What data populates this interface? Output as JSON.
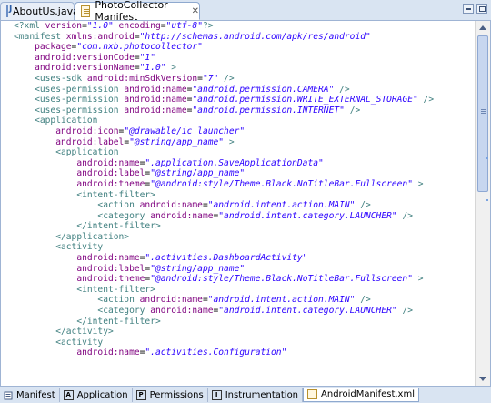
{
  "tabs": [
    {
      "label": "AboutUs.java",
      "icon": "java-file-icon",
      "active": false
    },
    {
      "label": "PhotoCollector Manifest",
      "icon": "xml-file-icon",
      "active": true
    }
  ],
  "close_glyph": "✕",
  "code_lines": [
    {
      "indent": 0,
      "fold": false,
      "warn": true,
      "parts": [
        {
          "t": "<?xml ",
          "c": "pi"
        },
        {
          "t": "version",
          "c": "attr"
        },
        {
          "t": "=",
          "c": ""
        },
        {
          "t": "\"1.0\"",
          "c": "val"
        },
        {
          "t": " ",
          "c": ""
        },
        {
          "t": "encoding",
          "c": "attr"
        },
        {
          "t": "=",
          "c": ""
        },
        {
          "t": "\"utf-8\"",
          "c": "val"
        },
        {
          "t": "?>",
          "c": "pi"
        }
      ]
    },
    {
      "indent": 0,
      "fold": true,
      "parts": [
        {
          "t": "<manifest ",
          "c": "tag"
        },
        {
          "t": "xmlns:android",
          "c": "attr"
        },
        {
          "t": "=",
          "c": ""
        },
        {
          "t": "\"http://schemas.android.com/apk/res/android\"",
          "c": "val"
        }
      ]
    },
    {
      "indent": 4,
      "parts": [
        {
          "t": "package",
          "c": "attr"
        },
        {
          "t": "=",
          "c": ""
        },
        {
          "t": "\"com.nxb.photocollector\"",
          "c": "val"
        }
      ]
    },
    {
      "indent": 4,
      "parts": [
        {
          "t": "android:versionCode",
          "c": "attr"
        },
        {
          "t": "=",
          "c": ""
        },
        {
          "t": "\"1\"",
          "c": "val"
        }
      ]
    },
    {
      "indent": 4,
      "parts": [
        {
          "t": "android:versionName",
          "c": "attr"
        },
        {
          "t": "=",
          "c": ""
        },
        {
          "t": "\"1.0\"",
          "c": "val"
        },
        {
          "t": " >",
          "c": "tag"
        }
      ]
    },
    {
      "indent": 4,
      "parts": [
        {
          "t": "<uses-sdk ",
          "c": "tag"
        },
        {
          "t": "android:minSdkVersion",
          "c": "attr"
        },
        {
          "t": "=",
          "c": ""
        },
        {
          "t": "\"7\"",
          "c": "val"
        },
        {
          "t": " />",
          "c": "tag"
        }
      ]
    },
    {
      "indent": 4,
      "parts": [
        {
          "t": "<uses-permission ",
          "c": "tag"
        },
        {
          "t": "android:name",
          "c": "attr"
        },
        {
          "t": "=",
          "c": ""
        },
        {
          "t": "\"android.permission.CAMERA\"",
          "c": "val"
        },
        {
          "t": " />",
          "c": "tag"
        }
      ]
    },
    {
      "indent": 4,
      "parts": [
        {
          "t": "<uses-permission ",
          "c": "tag"
        },
        {
          "t": "android:name",
          "c": "attr"
        },
        {
          "t": "=",
          "c": ""
        },
        {
          "t": "\"android.permission.WRITE_EXTERNAL_STORAGE\"",
          "c": "val"
        },
        {
          "t": " />",
          "c": "tag"
        }
      ]
    },
    {
      "indent": 4,
      "parts": [
        {
          "t": "<uses-permission ",
          "c": "tag"
        },
        {
          "t": "android:name",
          "c": "attr"
        },
        {
          "t": "=",
          "c": ""
        },
        {
          "t": "\"android.permission.INTERNET\"",
          "c": "val"
        },
        {
          "t": " />",
          "c": "tag"
        }
      ]
    },
    {
      "indent": 4,
      "fold": true,
      "parts": [
        {
          "t": "<application",
          "c": "tag"
        }
      ]
    },
    {
      "indent": 8,
      "parts": [
        {
          "t": "android:icon",
          "c": "attr"
        },
        {
          "t": "=",
          "c": ""
        },
        {
          "t": "\"@drawable/ic_launcher\"",
          "c": "val"
        }
      ]
    },
    {
      "indent": 8,
      "parts": [
        {
          "t": "android:label",
          "c": "attr"
        },
        {
          "t": "=",
          "c": ""
        },
        {
          "t": "\"@string/app_name\"",
          "c": "val"
        },
        {
          "t": " >",
          "c": "tag"
        }
      ]
    },
    {
      "indent": 8,
      "fold": true,
      "parts": [
        {
          "t": "<application",
          "c": "tag"
        }
      ]
    },
    {
      "indent": 12,
      "parts": [
        {
          "t": "android:name",
          "c": "attr"
        },
        {
          "t": "=",
          "c": ""
        },
        {
          "t": "\".application.SaveApplicationData\"",
          "c": "val"
        }
      ]
    },
    {
      "indent": 12,
      "parts": [
        {
          "t": "android:label",
          "c": "attr"
        },
        {
          "t": "=",
          "c": ""
        },
        {
          "t": "\"@string/app_name\"",
          "c": "val"
        }
      ]
    },
    {
      "indent": 12,
      "parts": [
        {
          "t": "android:theme",
          "c": "attr"
        },
        {
          "t": "=",
          "c": ""
        },
        {
          "t": "\"@android:style/Theme.Black.NoTitleBar.Fullscreen\"",
          "c": "val"
        },
        {
          "t": " >",
          "c": "tag"
        }
      ]
    },
    {
      "indent": 12,
      "fold": true,
      "parts": [
        {
          "t": "<intent-filter>",
          "c": "tag"
        }
      ]
    },
    {
      "indent": 16,
      "parts": [
        {
          "t": "<action ",
          "c": "tag"
        },
        {
          "t": "android:name",
          "c": "attr"
        },
        {
          "t": "=",
          "c": ""
        },
        {
          "t": "\"android.intent.action.MAIN\"",
          "c": "val"
        },
        {
          "t": " />",
          "c": "tag"
        }
      ]
    },
    {
      "indent": 16,
      "parts": [
        {
          "t": "<category ",
          "c": "tag"
        },
        {
          "t": "android:name",
          "c": "attr"
        },
        {
          "t": "=",
          "c": ""
        },
        {
          "t": "\"android.intent.category.LAUNCHER\"",
          "c": "val"
        },
        {
          "t": " />",
          "c": "tag"
        }
      ]
    },
    {
      "indent": 12,
      "parts": [
        {
          "t": "</intent-filter>",
          "c": "tag"
        }
      ]
    },
    {
      "indent": 8,
      "parts": [
        {
          "t": "</application>",
          "c": "tag"
        }
      ]
    },
    {
      "indent": 8,
      "fold": true,
      "parts": [
        {
          "t": "<activity",
          "c": "tag"
        }
      ]
    },
    {
      "indent": 12,
      "parts": [
        {
          "t": "android:name",
          "c": "attr"
        },
        {
          "t": "=",
          "c": ""
        },
        {
          "t": "\".activities.DashboardActivity\"",
          "c": "val"
        }
      ]
    },
    {
      "indent": 12,
      "parts": [
        {
          "t": "android:label",
          "c": "attr"
        },
        {
          "t": "=",
          "c": ""
        },
        {
          "t": "\"@string/app_name\"",
          "c": "val"
        }
      ]
    },
    {
      "indent": 12,
      "parts": [
        {
          "t": "android:theme",
          "c": "attr"
        },
        {
          "t": "=",
          "c": ""
        },
        {
          "t": "\"@android:style/Theme.Black.NoTitleBar.Fullscreen\"",
          "c": "val"
        },
        {
          "t": " >",
          "c": "tag"
        }
      ]
    },
    {
      "indent": 12,
      "fold": true,
      "parts": [
        {
          "t": "<intent-filter>",
          "c": "tag"
        }
      ]
    },
    {
      "indent": 16,
      "parts": [
        {
          "t": "<action ",
          "c": "tag"
        },
        {
          "t": "android:name",
          "c": "attr"
        },
        {
          "t": "=",
          "c": ""
        },
        {
          "t": "\"android.intent.action.MAIN\"",
          "c": "val"
        },
        {
          "t": " />",
          "c": "tag"
        }
      ]
    },
    {
      "indent": 16,
      "parts": [
        {
          "t": "<category ",
          "c": "tag"
        },
        {
          "t": "android:name",
          "c": "attr"
        },
        {
          "t": "=",
          "c": ""
        },
        {
          "t": "\"android.intent.category.LAUNCHER\"",
          "c": "val"
        },
        {
          "t": " />",
          "c": "tag"
        }
      ]
    },
    {
      "indent": 12,
      "parts": [
        {
          "t": "</intent-filter>",
          "c": "tag"
        }
      ]
    },
    {
      "indent": 8,
      "parts": [
        {
          "t": "</activity>",
          "c": "tag"
        }
      ]
    },
    {
      "indent": 8,
      "fold": true,
      "parts": [
        {
          "t": "<activity",
          "c": "tag"
        }
      ]
    },
    {
      "indent": 12,
      "parts": [
        {
          "t": "android:name",
          "c": "attr"
        },
        {
          "t": "=",
          "c": ""
        },
        {
          "t": "\".activities.Configuration\"",
          "c": "val"
        }
      ]
    }
  ],
  "bottom_tabs": [
    {
      "label": "Manifest",
      "icon_char": "",
      "icon_name": "manifest-icon",
      "active": false
    },
    {
      "label": "Application",
      "icon_char": "A",
      "icon_name": "application-icon",
      "active": false
    },
    {
      "label": "Permissions",
      "icon_char": "P",
      "icon_name": "permissions-icon",
      "active": false
    },
    {
      "label": "Instrumentation",
      "icon_char": "I",
      "icon_name": "instrumentation-icon",
      "active": false
    },
    {
      "label": "AndroidManifest.xml",
      "icon_char": "",
      "icon_name": "xml-file-icon",
      "active": true
    }
  ],
  "colors": {
    "tag": "#3f7f7f",
    "attr": "#7f007f",
    "value": "#2a00ff",
    "tab_bar": "#d9e4f2"
  }
}
